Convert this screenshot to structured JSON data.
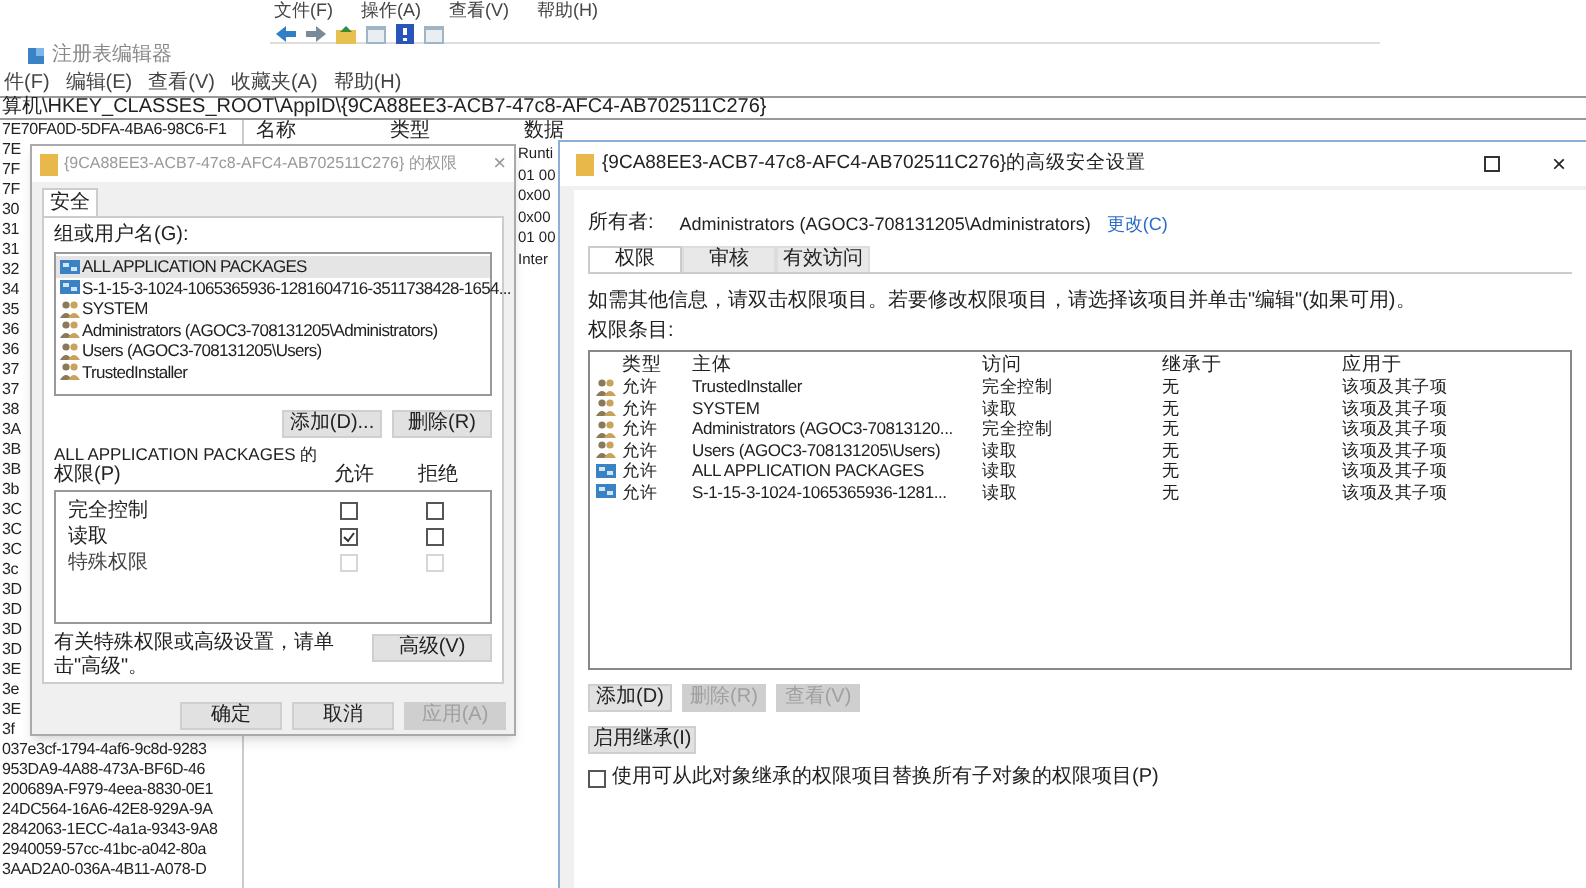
{
  "mmc_window": {
    "menu": [
      "文件(F)",
      "操作(A)",
      "查看(V)",
      "帮助(H)"
    ]
  },
  "registry": {
    "title": "注册表编辑器",
    "menu": [
      "件(F)",
      "编辑(E)",
      "查看(V)",
      "收藏夹(A)",
      "帮助(H)"
    ],
    "address": "算机\\HKEY_CLASSES_ROOT\\AppID\\{9CA88EE3-ACB7-47c8-AFC4-AB702511C276}",
    "tree_items": [
      "7E70FA0D-5DFA-4BA6-98C6-F1",
      "7E",
      "7F",
      "7F",
      "30",
      "31",
      "31",
      "32",
      "34",
      "35",
      "36",
      "36",
      "37",
      "37",
      "38",
      "3A",
      "3B",
      "3B",
      "3b",
      "3C",
      "3C",
      "3C",
      "3c",
      "3D",
      "3D",
      "3D",
      "3D",
      "3E",
      "3e",
      "3E",
      "3f",
      "037e3cf-1794-4af6-9c8d-9283",
      "953DA9-4A88-473A-BF6D-46",
      "200689A-F979-4eea-8830-0E1",
      "24DC564-16A6-42E8-929A-9A",
      "2842063-1ECC-4a1a-9343-9A8",
      "2940059-57cc-41bc-a042-80a",
      "3AAD2A0-036A-4B11-A078-D"
    ],
    "columns": [
      "名称",
      "类型",
      "数据"
    ],
    "data_values": [
      "Runti",
      "01 00",
      "0x00",
      "0x00",
      "01 00",
      "Inter"
    ]
  },
  "permissions_dialog": {
    "title": "{9CA88EE3-ACB7-47c8-AFC4-AB702511C276} 的权限",
    "close": "×",
    "tab": "安全",
    "users_label": "组或用户名(G):",
    "users": [
      {
        "kind": "package",
        "name": "ALL APPLICATION PACKAGES",
        "selected": true
      },
      {
        "kind": "package",
        "name": "S-1-15-3-1024-1065365936-1281604716-3511738428-1654...",
        "selected": false
      },
      {
        "kind": "group",
        "name": "SYSTEM",
        "selected": false
      },
      {
        "kind": "group",
        "name": "Administrators (AGOC3-708131205\\Administrators)",
        "selected": false
      },
      {
        "kind": "group",
        "name": "Users (AGOC3-708131205\\Users)",
        "selected": false
      },
      {
        "kind": "group",
        "name": "TrustedInstaller",
        "selected": false
      }
    ],
    "add_button": "添加(D)...",
    "remove_button": "删除(R)",
    "permissions_for": "ALL APPLICATION PACKAGES 的",
    "permissions_label": "权限(P)",
    "allow_header": "允许",
    "deny_header": "拒绝",
    "permissions": [
      {
        "name": "完全控制",
        "allow": false,
        "deny": false,
        "disabled": false
      },
      {
        "name": "读取",
        "allow": true,
        "deny": false,
        "disabled": false
      },
      {
        "name": "特殊权限",
        "allow": false,
        "deny": false,
        "disabled": true
      }
    ],
    "advanced_hint": "有关特殊权限或高级设置，请单击\"高级\"。",
    "advanced_button": "高级(V)",
    "buttons": [
      {
        "label": "确定",
        "disabled": false
      },
      {
        "label": "取消",
        "disabled": false
      },
      {
        "label": "应用(A)",
        "disabled": true
      }
    ]
  },
  "advanced_dialog": {
    "title": "{9CA88EE3-ACB7-47c8-AFC4-AB702511C276}的高级安全设置",
    "close": "×",
    "owner_label": "所有者:",
    "owner": "Administrators (AGOC3-708131205\\Administrators)",
    "change_link": "更改(C)",
    "tabs": [
      {
        "label": "权限",
        "selected": true
      },
      {
        "label": "审核",
        "selected": false
      },
      {
        "label": "有效访问",
        "selected": false
      }
    ],
    "info": "如需其他信息，请双击权限项目。若要修改权限项目，请选择该项目并单击\"编辑\"(如果可用)。",
    "entries_label": "权限条目:",
    "table": {
      "columns": [
        "类型",
        "主体",
        "访问",
        "继承于",
        "应用于"
      ],
      "rows": [
        {
          "kind": "group",
          "cells": [
            "允许",
            "TrustedInstaller",
            "完全控制",
            "无",
            "该项及其子项"
          ]
        },
        {
          "kind": "group",
          "cells": [
            "允许",
            "SYSTEM",
            "读取",
            "无",
            "该项及其子项"
          ]
        },
        {
          "kind": "group",
          "cells": [
            "允许",
            "Administrators (AGOC3-70813120...",
            "完全控制",
            "无",
            "该项及其子项"
          ]
        },
        {
          "kind": "group",
          "cells": [
            "允许",
            "Users (AGOC3-708131205\\Users)",
            "读取",
            "无",
            "该项及其子项"
          ]
        },
        {
          "kind": "package",
          "cells": [
            "允许",
            "ALL APPLICATION PACKAGES",
            "读取",
            "无",
            "该项及其子项"
          ]
        },
        {
          "kind": "package",
          "cells": [
            "允许",
            "S-1-15-3-1024-1065365936-1281...",
            "读取",
            "无",
            "该项及其子项"
          ]
        }
      ]
    },
    "buttons": [
      {
        "label": "添加(D)",
        "disabled": false
      },
      {
        "label": "删除(R)",
        "disabled": true
      },
      {
        "label": "查看(V)",
        "disabled": true
      }
    ],
    "inherit_button": "启用继承(I)",
    "replace_checkbox": {
      "label": "使用可从此对象继承的权限项目替换所有子对象的权限项目(P)",
      "checked": false
    }
  }
}
